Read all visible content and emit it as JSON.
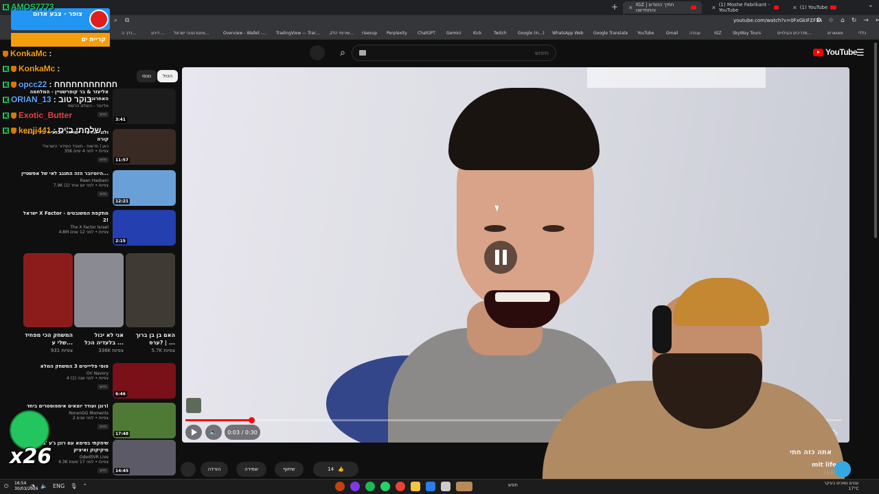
{
  "browser": {
    "tabs": [
      {
        "label": "IGZ | חתיך החודש והתחדשנו"
      },
      {
        "label": "(1) Moshe Fabrikant - YouTube"
      },
      {
        "label": "(1) YouTube"
      }
    ],
    "url": "youtube.com/watch?v=0FxGkIFZF3A",
    "bookmarks": [
      "דרך ה...",
      "דירוג ...",
      "אינטרנטיבי ישראל...",
      "Overview - Wallet -...",
      "TradingView — Trac...",
      "שירותי הלק...",
      "risexup",
      "Perplexity",
      "ChatGPT",
      "Gemini",
      "Kick",
      "Twitch",
      "Google (תי...)",
      "WhatsApp Web",
      "Google Translate",
      "YouTube",
      "Gmail",
      "עבודה",
      "IGZ",
      "SkyWay Tours",
      "מדריכים והגילויים...",
      "מאושרים",
      "כללי"
    ]
  },
  "youtube": {
    "logo": "YouTube",
    "search_placeholder": "חיפוש",
    "chips": {
      "all": "הכול",
      "related": "נצפו"
    }
  },
  "stream_overlay": {
    "alert_title": "צופר - צבע אדום",
    "alert_sub": "קריית ים",
    "chat": [
      {
        "user": "AMOS7773",
        "msg": ""
      },
      {
        "user": "KonkaMc",
        "msg": ":"
      },
      {
        "user": "KonkaMc",
        "msg": ":"
      },
      {
        "user": "opcc22",
        "msg": ": חחחחחחחחחחח"
      },
      {
        "user": "ORIAN_13",
        "msg": ": בוקר טוב"
      },
      {
        "user": "Exotic_Butter",
        "msg": ""
      },
      {
        "user": "kenji441",
        "msg": ": שלחתי ב'יס"
      }
    ],
    "emote_count": "x26"
  },
  "recommendations": [
    {
      "title": "אליעזר & בר קופרשטיין - המלחמה האחרונה",
      "channel": "אליעזר - העולם הרשמי",
      "views": "",
      "duration": "3:41",
      "badge": "חדש"
    },
    {
      "title": "ולוג חופשי - ישראל מבפנים מה באמת קורה",
      "channel": "כאן | חדשות - תאגיד השידור הישראלי",
      "views": "35K צפיות • לפני 4 ימים",
      "duration": "11:57",
      "badge": "חדש"
    },
    {
      "title": "היוטיובר הזה התנגב לאי של אפשטיין...",
      "channel": "Raen Hasbani",
      "views": "7.9K צפיות • לפני יום אחד (1)",
      "duration": "12:21",
      "badge": "חדש"
    },
    {
      "title": "ישראל X Factor - מתקפת המשובטים 2!",
      "channel": "The X Factor Israel",
      "views": "4.8M צפיות • לפני 12 שנים",
      "duration": "2:15",
      "badge": ""
    }
  ],
  "shorts": [
    {
      "title": "האם בן בן ברוך ערס? | ...",
      "views": "5.7K צפיות"
    },
    {
      "title": "אני לא יכול בלעדיה הכל ...",
      "views": "336K צפיות"
    },
    {
      "title": "המשחק הכי מפחיד שלי ע...",
      "views": "931 צפיות"
    }
  ],
  "recommendations2": [
    {
      "title": "פופי פליייטים 3 המשחק המלא",
      "channel": "Ori Navory",
      "views": "4 צפיות • לפני שנה (1)",
      "duration": "6:46",
      "badge": "חדש"
    },
    {
      "title": "רונן ועודד יוצאים אימפוסטרים ביחד!",
      "channel": "RonenGG Moments",
      "views": "2 צפיות • לפני שנים",
      "duration": "17:48",
      "badge": "חדש"
    },
    {
      "title": "שיחקתי בסימא עם רונן ג'ע 'ב גג'ע מיקיקוק ואיציק",
      "channel": "OdedSVR Live",
      "views": "4.3K צפיות • לפני 17 שעות",
      "duration": "14:45",
      "badge": "חדש"
    }
  ],
  "player": {
    "time": "0:03 / 0:30",
    "progress": 0.1
  },
  "video": {
    "title": "אתה כזה חתי",
    "channel": "mit life",
    "subs": "28 מנויים",
    "likes": "14",
    "actions": {
      "share": "שיתוף",
      "save": "שמירה",
      "download": "הורדה"
    }
  },
  "taskbar": {
    "time": "16:54",
    "date": "30/03/2026",
    "lang": "ENG",
    "search": "חפש",
    "weather": "עננים נמוכים בעיקר",
    "temp": "17°C"
  }
}
